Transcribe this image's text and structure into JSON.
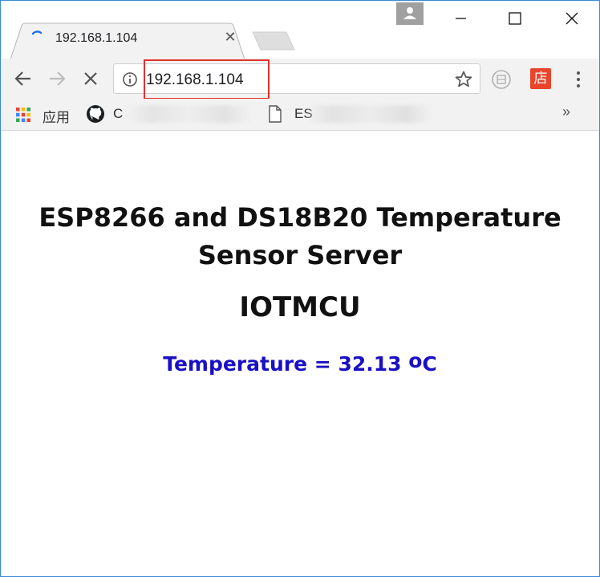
{
  "browser": {
    "tab": {
      "title": "192.168.1.104",
      "close_glyph": "✕"
    },
    "window_controls": {
      "minimize": "minimize-icon",
      "maximize": "maximize-icon",
      "close": "close-icon"
    },
    "omnibox": {
      "url": "192.168.1.104"
    },
    "toolbar_icons": [
      "back-icon",
      "forward-icon",
      "stop-icon",
      "info-icon",
      "star-icon",
      "extension-icon",
      "menu-icon"
    ],
    "extension_badge": "店",
    "bookmarks": {
      "apps_label": "应用",
      "item1_visible": "C",
      "item2_visible": "ES",
      "more_glyph": "»"
    },
    "highlight_color": "#e0322b",
    "accent_color": "#3c8ad6"
  },
  "page": {
    "heading": "ESP8266 and DS18B20 Temperature Sensor Server",
    "brand": "IOTMCU",
    "temperature": {
      "label": "Temperature",
      "equals": "=",
      "value": "32.13",
      "degree": "o",
      "unit": "C"
    },
    "temperature_color": "#1a10c4"
  }
}
